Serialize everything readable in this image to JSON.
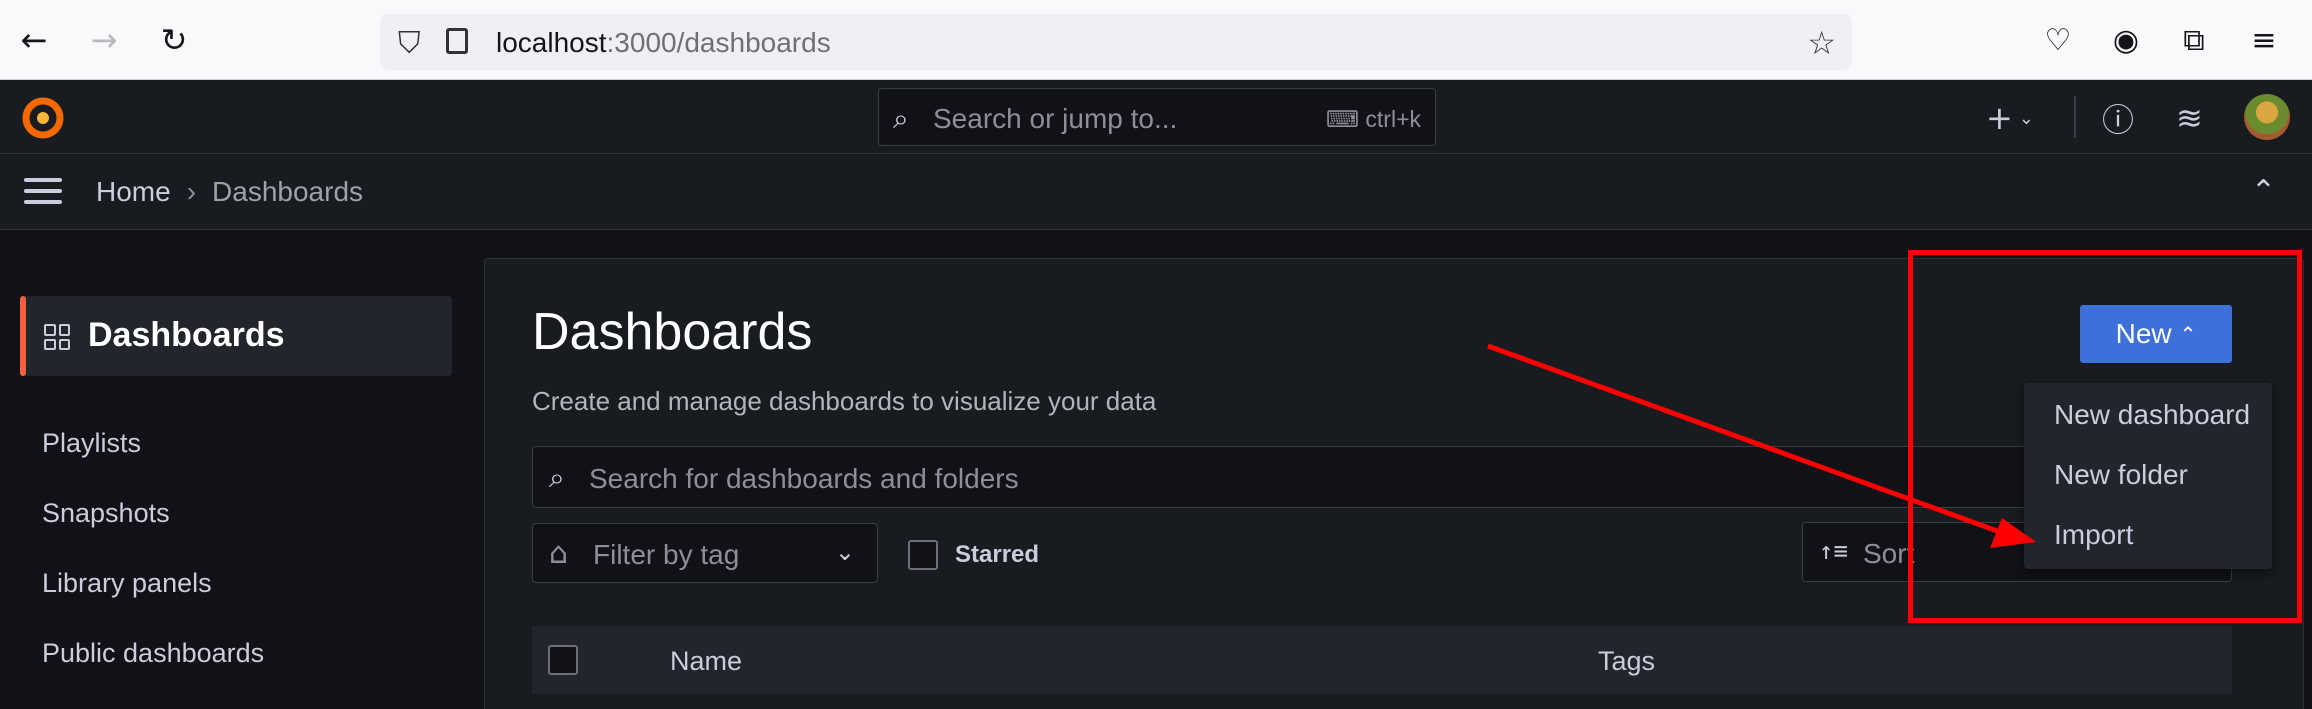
{
  "browser": {
    "url_host": "localhost",
    "url_path": ":3000/dashboards"
  },
  "topbar": {
    "search_placeholder": "Search or jump to...",
    "search_shortcut": "ctrl+k",
    "add_label": "+"
  },
  "breadcrumb": {
    "home": "Home",
    "separator": "›",
    "current": "Dashboards"
  },
  "sidebar": {
    "active": "Dashboards",
    "items": [
      "Playlists",
      "Snapshots",
      "Library panels",
      "Public dashboards"
    ]
  },
  "main": {
    "title": "Dashboards",
    "subtitle": "Create and manage dashboards to visualize your data",
    "search_placeholder": "Search for dashboards and folders",
    "tag_filter_placeholder": "Filter by tag",
    "starred_label": "Starred",
    "sort_placeholder": "Sort",
    "columns": [
      "Name",
      "Tags"
    ],
    "new_button": "New",
    "new_menu": [
      "New dashboard",
      "New folder",
      "Import"
    ]
  },
  "colors": {
    "accent_blue": "#3d71d9",
    "active_marker": "#f55f3e",
    "annotation_red": "#ff0000"
  }
}
